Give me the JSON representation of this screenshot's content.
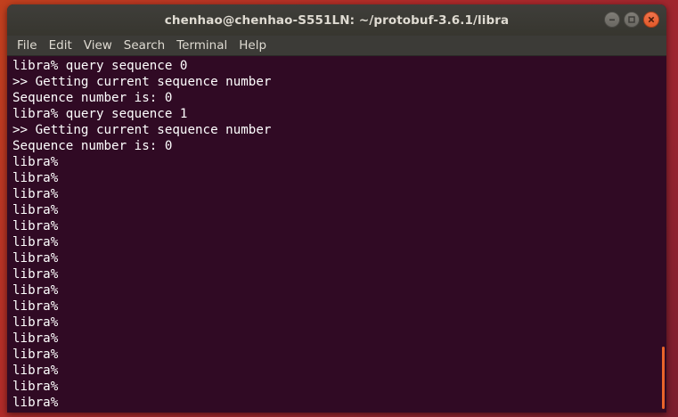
{
  "window": {
    "title": "chenhao@chenhao-S551LN: ~/protobuf-3.6.1/libra"
  },
  "menu": {
    "items": [
      {
        "label": "File"
      },
      {
        "label": "Edit"
      },
      {
        "label": "View"
      },
      {
        "label": "Search"
      },
      {
        "label": "Terminal"
      },
      {
        "label": "Help"
      }
    ]
  },
  "terminal": {
    "lines": [
      "libra% query sequence 0",
      ">> Getting current sequence number",
      "Sequence number is: 0",
      "libra% query sequence 1",
      ">> Getting current sequence number",
      "Sequence number is: 0",
      "libra%",
      "libra%",
      "libra%",
      "libra%",
      "libra%",
      "libra%",
      "libra%",
      "libra%",
      "libra%",
      "libra%",
      "libra%",
      "libra%",
      "libra%",
      "libra%",
      "libra%",
      "libra%"
    ]
  },
  "colors": {
    "terminal_bg": "#300a24",
    "terminal_fg": "#ffffff",
    "titlebar_bg": "#3c3b37",
    "close_button": "#e95420",
    "scroll_thumb": "#e9642a"
  },
  "icons": {
    "minimize": "minimize-icon",
    "maximize": "maximize-icon",
    "close": "close-icon"
  }
}
